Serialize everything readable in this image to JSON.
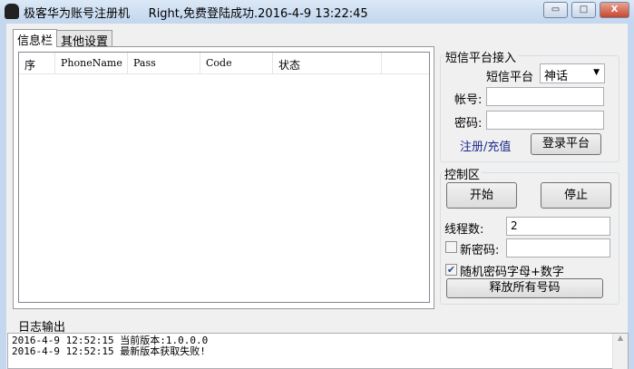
{
  "window": {
    "title": "极客华为账号注册机     Right,免费登陆成功.2016-4-9 13:22:45",
    "minimize": "▭",
    "maximize": "□",
    "close": "X"
  },
  "tabs": [
    "信息栏",
    "其他设置"
  ],
  "list": {
    "columns": [
      "序",
      "PhoneName",
      "Pass",
      "Code",
      "状态",
      ""
    ]
  },
  "sms": {
    "group_label": "短信平台接入",
    "platform_label": "短信平台",
    "platform_value": "神话",
    "account_label": "帐号:",
    "account_value": "",
    "password_label": "密码:",
    "password_value": "",
    "register_link": "注册/充值",
    "login_button": "登录平台"
  },
  "control": {
    "group_label": "控制区",
    "start_button": "开始",
    "stop_button": "停止",
    "threads_label": "线程数:",
    "threads_value": "2",
    "new_password_label": "新密码:",
    "new_password_checked": false,
    "new_password_value": "",
    "random_password_label": "随机密码字母+数字",
    "random_password_checked": true,
    "release_button": "释放所有号码"
  },
  "log": {
    "label": "日志输出",
    "lines": [
      "2016-4-9 12:52:15 当前版本:1.0.0.0",
      "2016-4-9 12:52:15 最新版本获取失败!"
    ]
  }
}
